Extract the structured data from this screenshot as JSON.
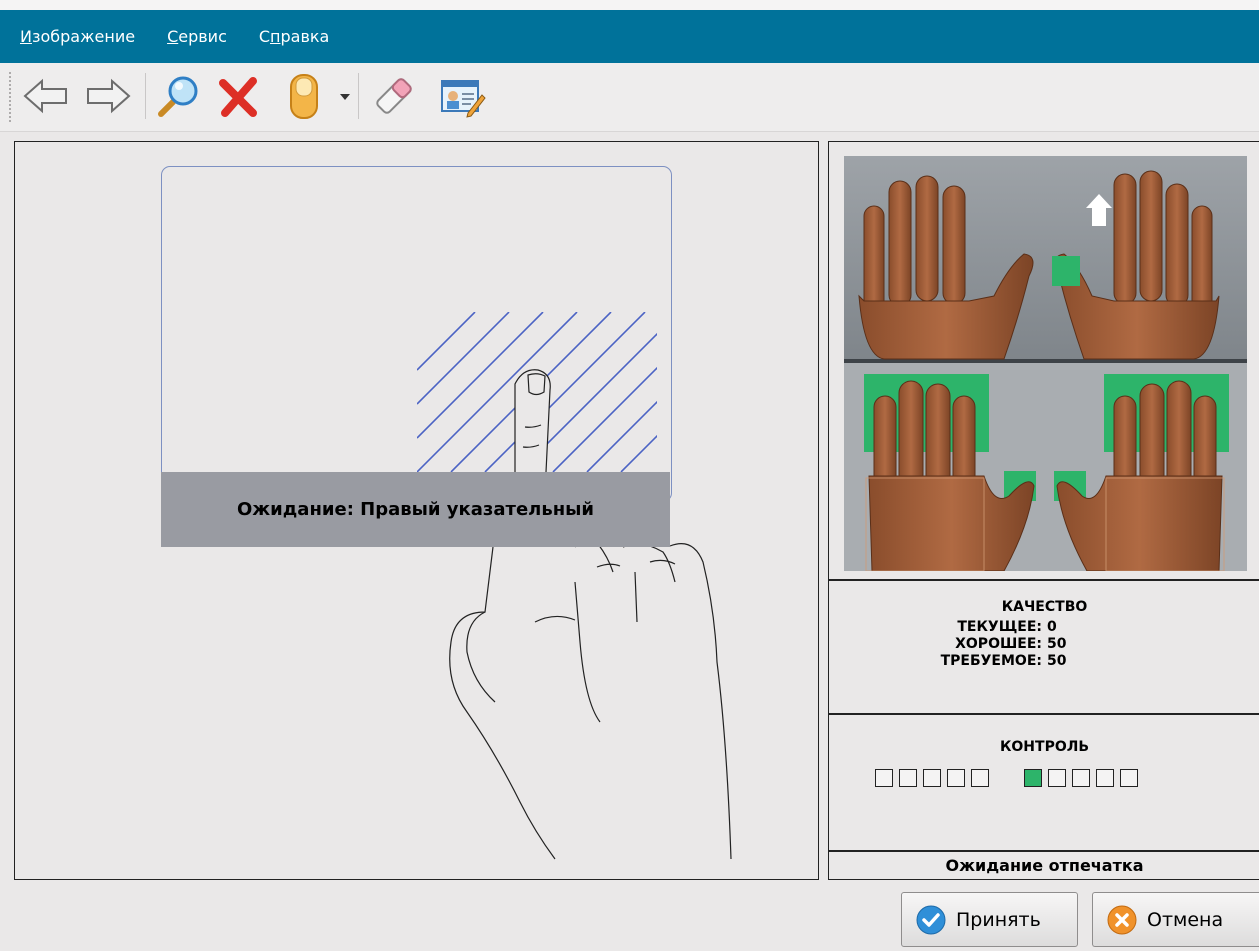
{
  "menu": {
    "items": [
      {
        "accel": "И",
        "rest": "зображение"
      },
      {
        "accel": "С",
        "rest": "ервис"
      },
      {
        "pre": "С",
        "accel": "п",
        "rest": "равка"
      }
    ]
  },
  "toolbar": {
    "icons": [
      "back-arrow-icon",
      "forward-arrow-icon",
      "magnifier-icon",
      "delete-x-icon",
      "finger-icon",
      "dropdown-arrow-icon",
      "eraser-icon",
      "id-card-edit-icon"
    ]
  },
  "capture": {
    "status": "Ожидание: Правый указательный"
  },
  "quality": {
    "title": "КАЧЕСТВО",
    "current_label": "ТЕКУЩЕЕ:",
    "current_value": "0",
    "good_label": "ХОРОШЕЕ:",
    "good_value": "50",
    "required_label": "ТРЕБУЕМОЕ:",
    "required_value": "50"
  },
  "control": {
    "title": "КОНТРОЛЬ",
    "left_hand": [
      false,
      false,
      false,
      false,
      false
    ],
    "right_hand": [
      true,
      false,
      false,
      false,
      false
    ]
  },
  "status_bar": {
    "text": "Ожидание отпечатка"
  },
  "buttons": {
    "accept": "Принять",
    "cancel": "Отмена"
  },
  "colors": {
    "menubar": "#00729a",
    "highlight": "#2db46a",
    "banner": "#999ba2",
    "frame": "#7d90c2"
  }
}
